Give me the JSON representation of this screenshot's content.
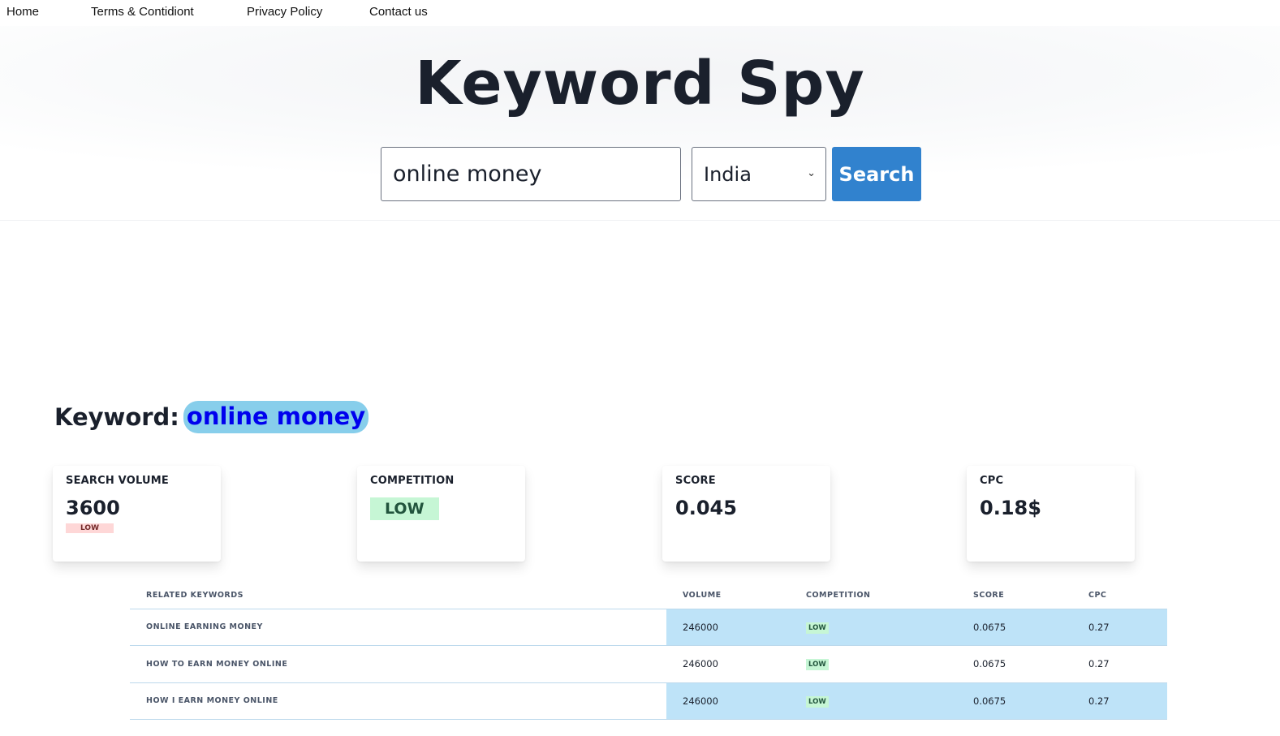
{
  "nav": {
    "items": [
      {
        "label": "Home"
      },
      {
        "label": "Terms & Contidiont"
      },
      {
        "label": "Privacy Policy"
      },
      {
        "label": "Contact us"
      }
    ]
  },
  "hero": {
    "title": "Keyword Spy",
    "search_value": "online money",
    "country": "India",
    "search_button": "Search"
  },
  "keyword": {
    "label": "Keyword:",
    "value": "online money"
  },
  "stats": [
    {
      "label": "SEARCH VOLUME",
      "value": "3600",
      "badge": "LOW"
    },
    {
      "label": "COMPETITION",
      "badge": "LOW"
    },
    {
      "label": "SCORE",
      "value": "0.045"
    },
    {
      "label": "CPC",
      "value": "0.18$"
    }
  ],
  "table": {
    "headers": [
      "RELATED KEYWORDS",
      "VOLUME",
      "COMPETITION",
      "SCORE",
      "CPC"
    ],
    "rows": [
      {
        "keyword": "ONLINE EARNING MONEY",
        "volume": "246000",
        "competition": "LOW",
        "score": "0.0675",
        "cpc": "0.27"
      },
      {
        "keyword": "HOW TO EARN MONEY ONLINE",
        "volume": "246000",
        "competition": "LOW",
        "score": "0.0675",
        "cpc": "0.27"
      },
      {
        "keyword": "HOW I EARN MONEY ONLINE",
        "volume": "246000",
        "competition": "LOW",
        "score": "0.0675",
        "cpc": "0.27"
      }
    ]
  },
  "colors": {
    "accent": "#3182ce",
    "highlight_row": "#bee3f8",
    "keyword_pill": "#87ceeb",
    "badge_low_red": "#fed7d7",
    "badge_low_green": "#c6f6d5"
  }
}
